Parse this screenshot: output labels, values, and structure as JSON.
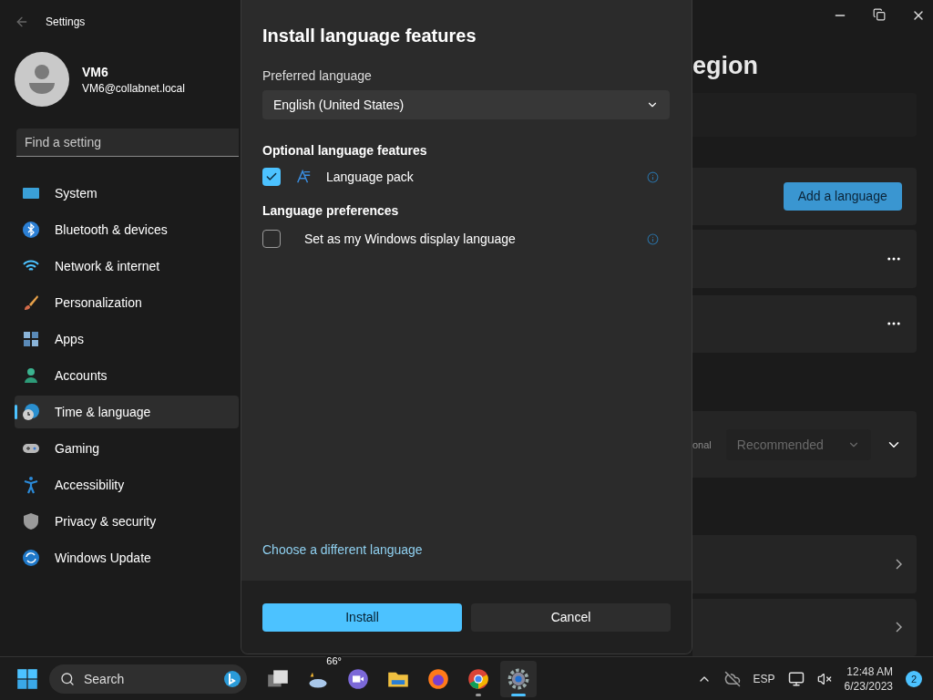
{
  "window": {
    "title": "Settings"
  },
  "profile": {
    "name": "VM6",
    "email": "VM6@collabnet.local"
  },
  "search": {
    "placeholder": "Find a setting"
  },
  "sidebar": {
    "items": [
      {
        "label": "System",
        "selected": false
      },
      {
        "label": "Bluetooth & devices",
        "selected": false
      },
      {
        "label": "Network & internet",
        "selected": false
      },
      {
        "label": "Personalization",
        "selected": false
      },
      {
        "label": "Apps",
        "selected": false
      },
      {
        "label": "Accounts",
        "selected": false
      },
      {
        "label": "Time & language",
        "selected": true
      },
      {
        "label": "Gaming",
        "selected": false
      },
      {
        "label": "Accessibility",
        "selected": false
      },
      {
        "label": "Privacy & security",
        "selected": false
      },
      {
        "label": "Windows Update",
        "selected": false
      }
    ]
  },
  "page": {
    "title": "egion",
    "cards": [
      {
        "kind": "blank"
      },
      {
        "kind": "button",
        "label": "Add a language"
      },
      {
        "kind": "more"
      },
      {
        "kind": "more"
      },
      {
        "kind": "select",
        "label": "onal",
        "value": "Recommended",
        "disabled": true
      },
      {
        "kind": "link"
      },
      {
        "kind": "link"
      }
    ]
  },
  "dialog": {
    "title": "Install language features",
    "preferred_label": "Preferred language",
    "preferred_value": "English (United States)",
    "sections": [
      {
        "heading": "Optional language features",
        "options": [
          {
            "label": "Language pack",
            "checked": true,
            "kind": "pack"
          }
        ]
      },
      {
        "heading": "Language preferences",
        "options": [
          {
            "label": "Set as my Windows display language",
            "checked": false,
            "kind": "plain"
          }
        ]
      }
    ],
    "link": "Choose a different language",
    "buttons": [
      {
        "label": "Install",
        "kind": "primary"
      },
      {
        "label": "Cancel",
        "kind": "secondary"
      }
    ]
  },
  "taskbar": {
    "search_placeholder": "Search",
    "weather": "66°",
    "apps": [
      {
        "running": false,
        "selected": false
      },
      {
        "running": false,
        "selected": false
      },
      {
        "running": false,
        "selected": false
      },
      {
        "running": false,
        "selected": false
      },
      {
        "running": false,
        "selected": false
      },
      {
        "running": true,
        "selected": false
      },
      {
        "running": true,
        "selected": true
      }
    ],
    "language": "ESP",
    "time": "12:48 AM",
    "date": "6/23/2023",
    "notifications": "2"
  }
}
